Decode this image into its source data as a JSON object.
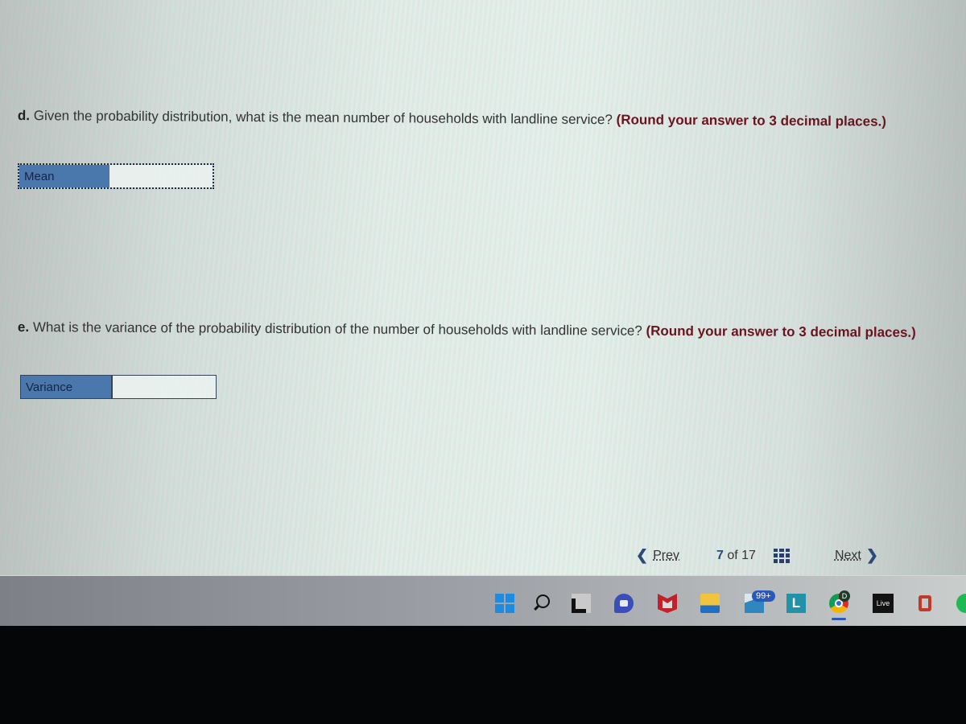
{
  "questions": {
    "d": {
      "part": "d.",
      "text": " Given the probability distribution, what is the mean number of households with landline service? ",
      "hint": "(Round your answer to 3 decimal places.)",
      "answer_label": "Mean",
      "answer_value": ""
    },
    "e": {
      "part": "e.",
      "text": " What is the variance of the probability distribution of the number of households with landline service? ",
      "hint": "(Round your answer to 3 decimal places.)",
      "answer_label": "Variance",
      "answer_value": ""
    }
  },
  "navigation": {
    "prev_label": "Prev",
    "current_page": "7",
    "of_label": "of",
    "total_pages": "17",
    "next_label": "Next",
    "prev_icon": "chevron-left-icon",
    "next_icon": "chevron-right-icon",
    "grid_icon": "grid-icon"
  },
  "taskbar": {
    "mail_badge": "99+",
    "l_app_letter": "L",
    "chrome_profile": "D",
    "live_label": "Live",
    "icons": [
      "windows-start-icon",
      "search-icon",
      "task-view-icon",
      "meet-icon",
      "mcafee-icon",
      "file-explorer-icon",
      "mail-icon",
      "l-app-icon",
      "chrome-icon",
      "live-icon",
      "office-icon",
      "spotify-icon"
    ]
  },
  "colors": {
    "hint_text": "#6b1420",
    "label_bg": "#4a78ad",
    "nav_accent": "#2a4a78"
  }
}
